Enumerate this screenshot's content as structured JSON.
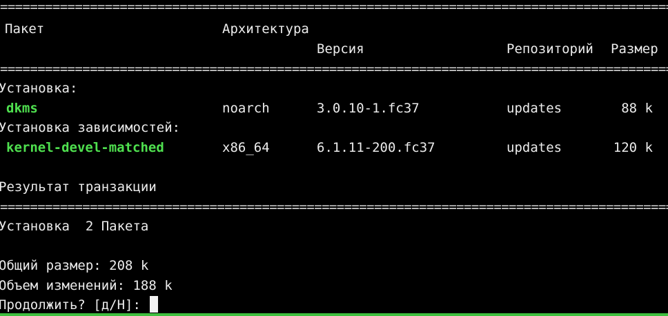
{
  "colors": {
    "background": "#000000",
    "text": "#ececec",
    "package_name": "#4fe04f",
    "focus_bar": "#3fbf3f"
  },
  "separator": "================================================================================================",
  "table": {
    "headers": {
      "package": "Пакет",
      "architecture": "Архитектура",
      "version": "Версия",
      "repository": "Репозиторий",
      "size": "Размер"
    },
    "sections": [
      {
        "title": "Установка:",
        "rows": [
          {
            "name": "dkms",
            "arch": "noarch",
            "version": "3.0.10-1.fc37",
            "repo": "updates",
            "size": "88 k"
          }
        ]
      },
      {
        "title": "Установка зависимостей:",
        "rows": [
          {
            "name": "kernel-devel-matched",
            "arch": "x86_64",
            "version": "6.1.11-200.fc37",
            "repo": "updates",
            "size": "120 k"
          }
        ]
      }
    ]
  },
  "summary": {
    "title": "Результат транзакции",
    "install_line": "Установка  2 Пакета",
    "total_size": "Общий размер: 208 k",
    "installed_size": "Объем изменений: 188 k",
    "prompt": "Продолжить? [д/Н]: "
  }
}
